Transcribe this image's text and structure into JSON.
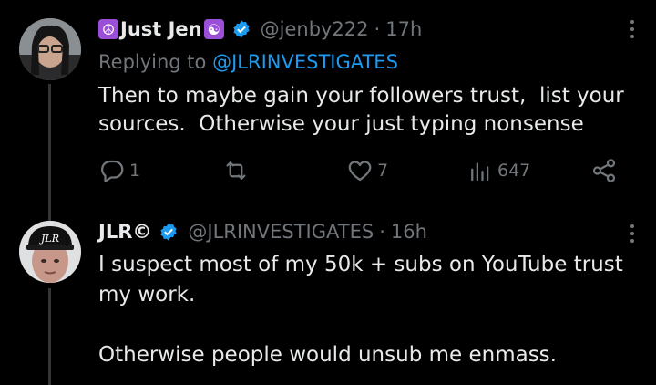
{
  "tweets": [
    {
      "display_name": "Just Jen",
      "name_emoji_left": "☮",
      "name_emoji_right": "☯",
      "handle": "@jenby222",
      "separator": "·",
      "time": "17h",
      "replying_prefix": "Replying to",
      "replying_to": "@JLRINVESTIGATES",
      "text": "Then to maybe gain your followers trust,  list your\nsources.  Otherwise your just typing nonsense",
      "actions": {
        "reply_count": "1",
        "retweet_count": "",
        "like_count": "7",
        "view_count": "647"
      }
    },
    {
      "display_name": "JLR©",
      "handle": "@JLRINVESTIGATES",
      "separator": "·",
      "time": "16h",
      "avatar_cap_text": "JLR",
      "text": "I suspect most of my 50k + subs on YouTube trust\nmy work.\n\nOtherwise people would unsub me enmass."
    }
  ],
  "colors": {
    "background": "#000000",
    "text": "#e7e9ea",
    "muted": "#71767b",
    "link": "#1d9bf0",
    "emoji_bg": "#9b4fd9"
  },
  "icons": [
    "verified-badge-icon",
    "more-icon",
    "reply-icon",
    "retweet-icon",
    "like-icon",
    "views-icon",
    "share-icon"
  ]
}
